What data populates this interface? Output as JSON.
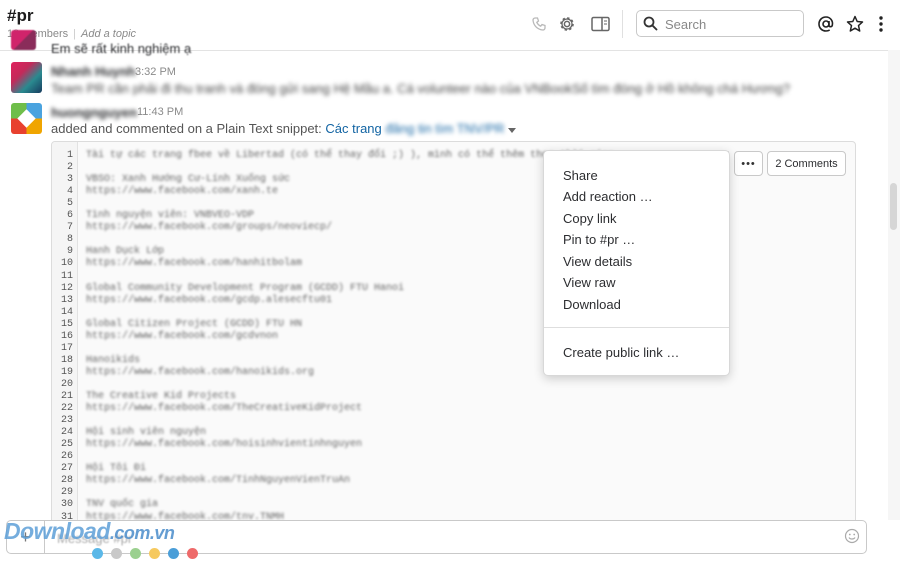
{
  "header": {
    "channel_name": "#pr",
    "members": "19 members",
    "add_topic": "Add a topic",
    "search_placeholder": "Search"
  },
  "messages": {
    "prev_text": "Em sẽ rất kinh nghiệm ạ",
    "msg1": {
      "author": "Nhanh Huynh",
      "time": "3:32 PM",
      "text": "Team PR cần phải đi thu tranh và đóng gửi sang Hệ Mầu a. Cá volunteer nào của VNBookSố tìm đóng ở Hồ không chá Hương?"
    },
    "msg2": {
      "author": "huongnguyen",
      "time": "11:43 PM",
      "prefix": "added and commented on a Plain Text snippet:",
      "link_text": "Các trang",
      "link_blurred": "đăng tin tìm TNV/PR"
    }
  },
  "snippet": {
    "line_numbers": [
      "1",
      "2",
      "3",
      "4",
      "5",
      "6",
      "7",
      "8",
      "9",
      "10",
      "11",
      "12",
      "13",
      "14",
      "15",
      "16",
      "17",
      "18",
      "19",
      "20",
      "21",
      "22",
      "23",
      "24",
      "25",
      "26",
      "27",
      "28",
      "29",
      "30",
      "31"
    ],
    "code_lines": [
      "Tài tự các trang fbee về Libertad (có thể thay đổi ;) ), mình có thể thêm theo thời gian",
      "",
      "VBSO: Xanh Hướng Cư-Lính Xuống sức",
      "https://www.facebook.com/xanh.te",
      "",
      "Tình nguyện viên: VNBVEO-VDP",
      "https://www.facebook.com/groups/neoviecp/",
      "",
      "Hanh Dụck Lớp",
      "https://www.facebook.com/hanhitbolam",
      "",
      "Global Community Development Program (GCDD) FTU Hanoi",
      "https://www.facebook.com/gcdp.alesecftu01",
      "",
      "Global Citizen Project (GCDD) FTU HN",
      "https://www.facebook.com/gcdvnon",
      "",
      "Hanoikids",
      "https://www.facebook.com/hanoikids.org",
      "",
      "The Creative Kid Projects",
      "https://www.facebook.com/TheCreativeKidProject",
      "",
      "Hội sinh viên nguyện",
      "https://www.facebook.com/hoisinhvientinhnguyen",
      "",
      "Hội Tôi Đi",
      "https://www.facebook.com/TinhNguyenVienTruAn",
      "",
      "TNV quốc gia",
      "https://www.facebook.com/tnv.TNMH"
    ],
    "more_label": "•••",
    "comments_label": "2 Comments"
  },
  "menu": {
    "items": [
      "Share",
      "Add reaction …",
      "Copy link",
      "Pin to #pr …",
      "View details",
      "View raw",
      "Download"
    ],
    "extra_item": "Create public link …"
  },
  "composer": {
    "placeholder": "Message #pr",
    "plus": "+"
  },
  "watermark": {
    "text": "Download",
    "domain": ".com.vn"
  },
  "colors": {
    "accent": "#1264a3",
    "watermark": "#5d9fd8",
    "dots": [
      "#5bb8e8",
      "#c9c9c9",
      "#9bd08f",
      "#f6c95e",
      "#4a9ed8",
      "#ee6a6a"
    ]
  }
}
